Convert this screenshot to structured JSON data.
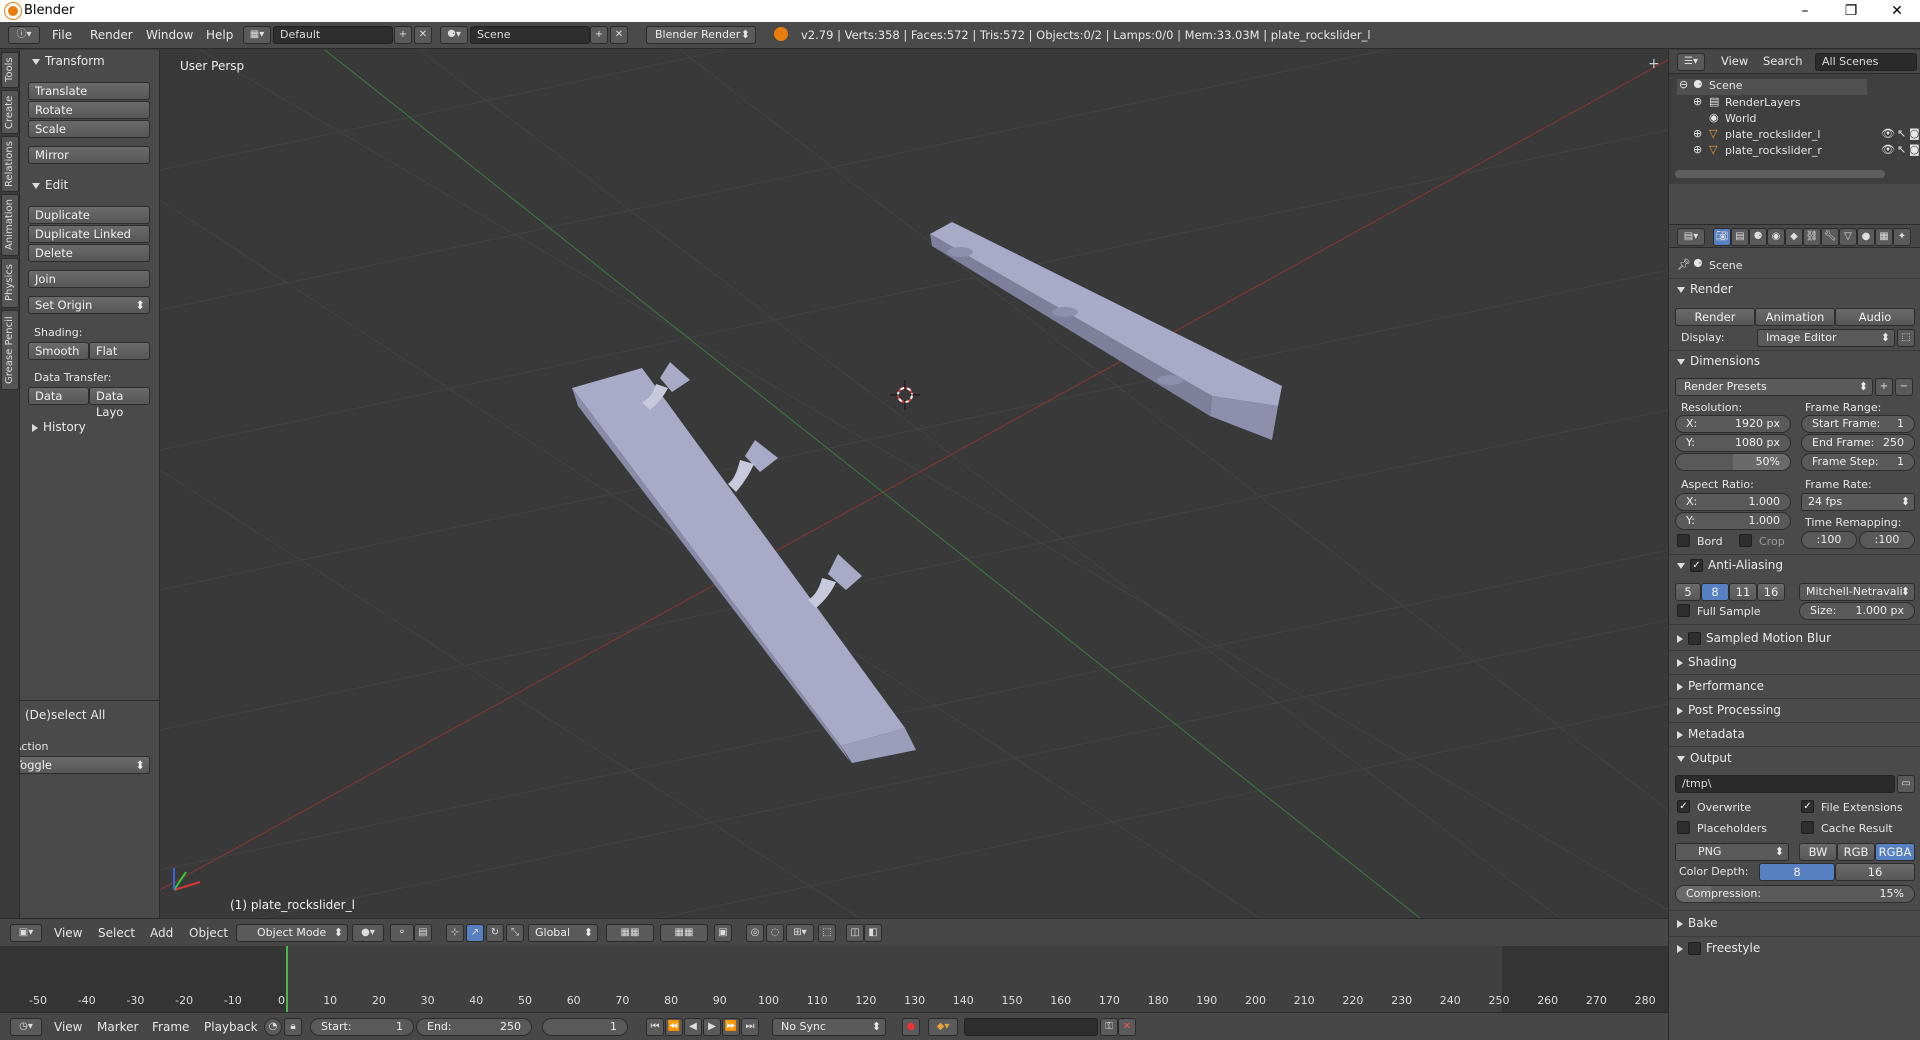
{
  "window": {
    "title": "Blender",
    "min": "–",
    "max": "❐",
    "close": "✕"
  },
  "infobar": {
    "menus": [
      "File",
      "Render",
      "Window",
      "Help"
    ],
    "layout": "Default",
    "scene": "Scene",
    "engine": "Blender Render",
    "stats": "v2.79 | Verts:358 | Faces:572 | Tris:572 | Objects:0/2 | Lamps:0/0 | Mem:33.03M | plate_rockslider_l"
  },
  "toolshelf": {
    "tabs": [
      "Tools",
      "Create",
      "Relations",
      "Animation",
      "Physics",
      "Grease Pencil"
    ],
    "transform": {
      "title": "Transform",
      "buttons": [
        "Translate",
        "Rotate",
        "Scale",
        "Mirror"
      ]
    },
    "edit": {
      "title": "Edit",
      "buttons": [
        "Duplicate",
        "Duplicate Linked",
        "Delete",
        "Join"
      ],
      "set_origin": "Set Origin",
      "shading_label": "Shading:",
      "smooth": "Smooth",
      "flat": "Flat",
      "data_transfer_label": "Data Transfer:",
      "data": "Data",
      "data_layo": "Data Layo"
    },
    "history": "History",
    "operator": {
      "title": "(De)select All",
      "action_label": "Action",
      "action_value": "Toggle"
    }
  },
  "viewport": {
    "view_label": "User Persp",
    "object_label": "(1) plate_rockslider_l"
  },
  "outliner": {
    "view": "View",
    "search": "Search",
    "filter": "All Scenes",
    "items": [
      {
        "name": "Scene"
      },
      {
        "name": "RenderLayers"
      },
      {
        "name": "World"
      },
      {
        "name": "plate_rockslider_l"
      },
      {
        "name": "plate_rockslider_r"
      }
    ]
  },
  "properties": {
    "scene": "Scene",
    "render": {
      "title": "Render",
      "render_btn": "Render",
      "animation_btn": "Animation",
      "audio_btn": "Audio",
      "display_label": "Display:",
      "display_value": "Image Editor"
    },
    "dimensions": {
      "title": "Dimensions",
      "presets": "Render Presets",
      "resolution_label": "Resolution:",
      "res_x": "X:",
      "res_x_val": "1920 px",
      "res_y": "Y:",
      "res_y_val": "1080 px",
      "res_pct": "50%",
      "frame_range_label": "Frame Range:",
      "start": "Start Frame:",
      "start_val": "1",
      "end": "End Frame:",
      "end_val": "250",
      "step": "Frame Step:",
      "step_val": "1",
      "aspect_label": "Aspect Ratio:",
      "asp_x": "X:",
      "asp_x_val": "1.000",
      "asp_y": "Y:",
      "asp_y_val": "1.000",
      "frame_rate_label": "Frame Rate:",
      "frame_rate": "24 fps",
      "bord": "Bord",
      "crop": "Crop",
      "time_remap_label": "Time Remapping:",
      "remap_old": ":100",
      "remap_new": ":100"
    },
    "aa": {
      "title": "Anti-Aliasing",
      "samples": [
        "5",
        "8",
        "11",
        "16"
      ],
      "filter": "Mitchell-Netravali",
      "full_sample": "Full Sample",
      "size_label": "Size:",
      "size_val": "1.000 px"
    },
    "collapsed": [
      "Sampled Motion Blur",
      "Shading",
      "Performance",
      "Post Processing",
      "Metadata"
    ],
    "output": {
      "title": "Output",
      "path": "/tmp\\",
      "overwrite": "Overwrite",
      "file_ext": "File Extensions",
      "placeholders": "Placeholders",
      "cache": "Cache Result",
      "format": "PNG",
      "bw": "BW",
      "rgb": "RGB",
      "rgba": "RGBA",
      "depth_label": "Color Depth:",
      "depth_8": "8",
      "depth_16": "16",
      "compression": "Compression:",
      "compression_val": "15%"
    },
    "bake": "Bake",
    "freestyle": "Freestyle"
  },
  "vp_header": {
    "menus": [
      "View",
      "Select",
      "Add",
      "Object"
    ],
    "mode": "Object Mode",
    "orientation": "Global"
  },
  "timeline": {
    "ticks": [
      "-50",
      "-40",
      "-30",
      "-20",
      "-10",
      "0",
      "10",
      "20",
      "30",
      "40",
      "50",
      "60",
      "70",
      "80",
      "90",
      "100",
      "110",
      "120",
      "130",
      "140",
      "150",
      "160",
      "170",
      "180",
      "190",
      "200",
      "210",
      "220",
      "230",
      "240",
      "250",
      "260",
      "270",
      "280"
    ],
    "menus": [
      "View",
      "Marker",
      "Frame",
      "Playback"
    ],
    "start_label": "Start:",
    "start": "1",
    "end_label": "End:",
    "end": "250",
    "current": "1",
    "sync": "No Sync"
  }
}
